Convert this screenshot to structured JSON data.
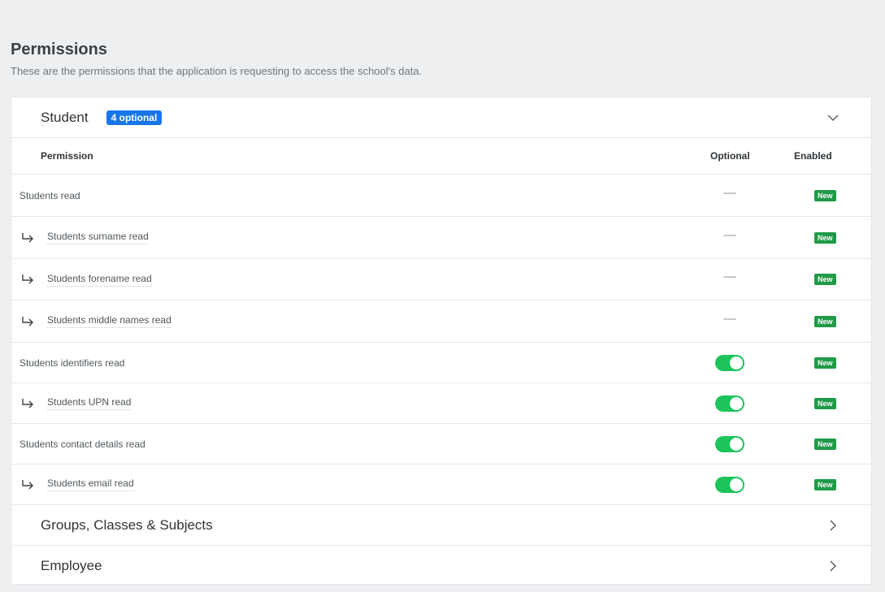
{
  "header": {
    "title": "Permissions",
    "subtitle": "These are the permissions that the application is requesting to access the school's data."
  },
  "sections": [
    {
      "title": "Student",
      "badge": "4 optional",
      "expanded": true,
      "chevron_icon": "chevron-down-icon"
    },
    {
      "title": "Groups, Classes & Subjects",
      "expanded": false,
      "chevron_icon": "chevron-right-icon"
    },
    {
      "title": "Employee",
      "expanded": false,
      "chevron_icon": "chevron-right-icon"
    }
  ],
  "table": {
    "columns": [
      "Permission",
      "Optional",
      "Enabled"
    ],
    "rows": [
      {
        "label": "Students read",
        "sub": false,
        "optional": "none",
        "enabled": "New"
      },
      {
        "label": "Students surname read",
        "sub": true,
        "optional": "none",
        "enabled": "New"
      },
      {
        "label": "Students forename read",
        "sub": true,
        "optional": "none",
        "enabled": "New"
      },
      {
        "label": "Students middle names read",
        "sub": true,
        "optional": "none",
        "enabled": "New"
      },
      {
        "label": "Students identifiers read",
        "sub": false,
        "optional": "on",
        "enabled": "New"
      },
      {
        "label": "Students UPN read",
        "sub": true,
        "optional": "on",
        "enabled": "New"
      },
      {
        "label": "Students contact details read",
        "sub": false,
        "optional": "on",
        "enabled": "New"
      },
      {
        "label": "Students email read",
        "sub": true,
        "optional": "on",
        "enabled": "New"
      }
    ]
  },
  "colors": {
    "badge_blue": "#1875ea",
    "toggle_green": "#1dc45c",
    "new_badge_green": "#1f9a48"
  }
}
